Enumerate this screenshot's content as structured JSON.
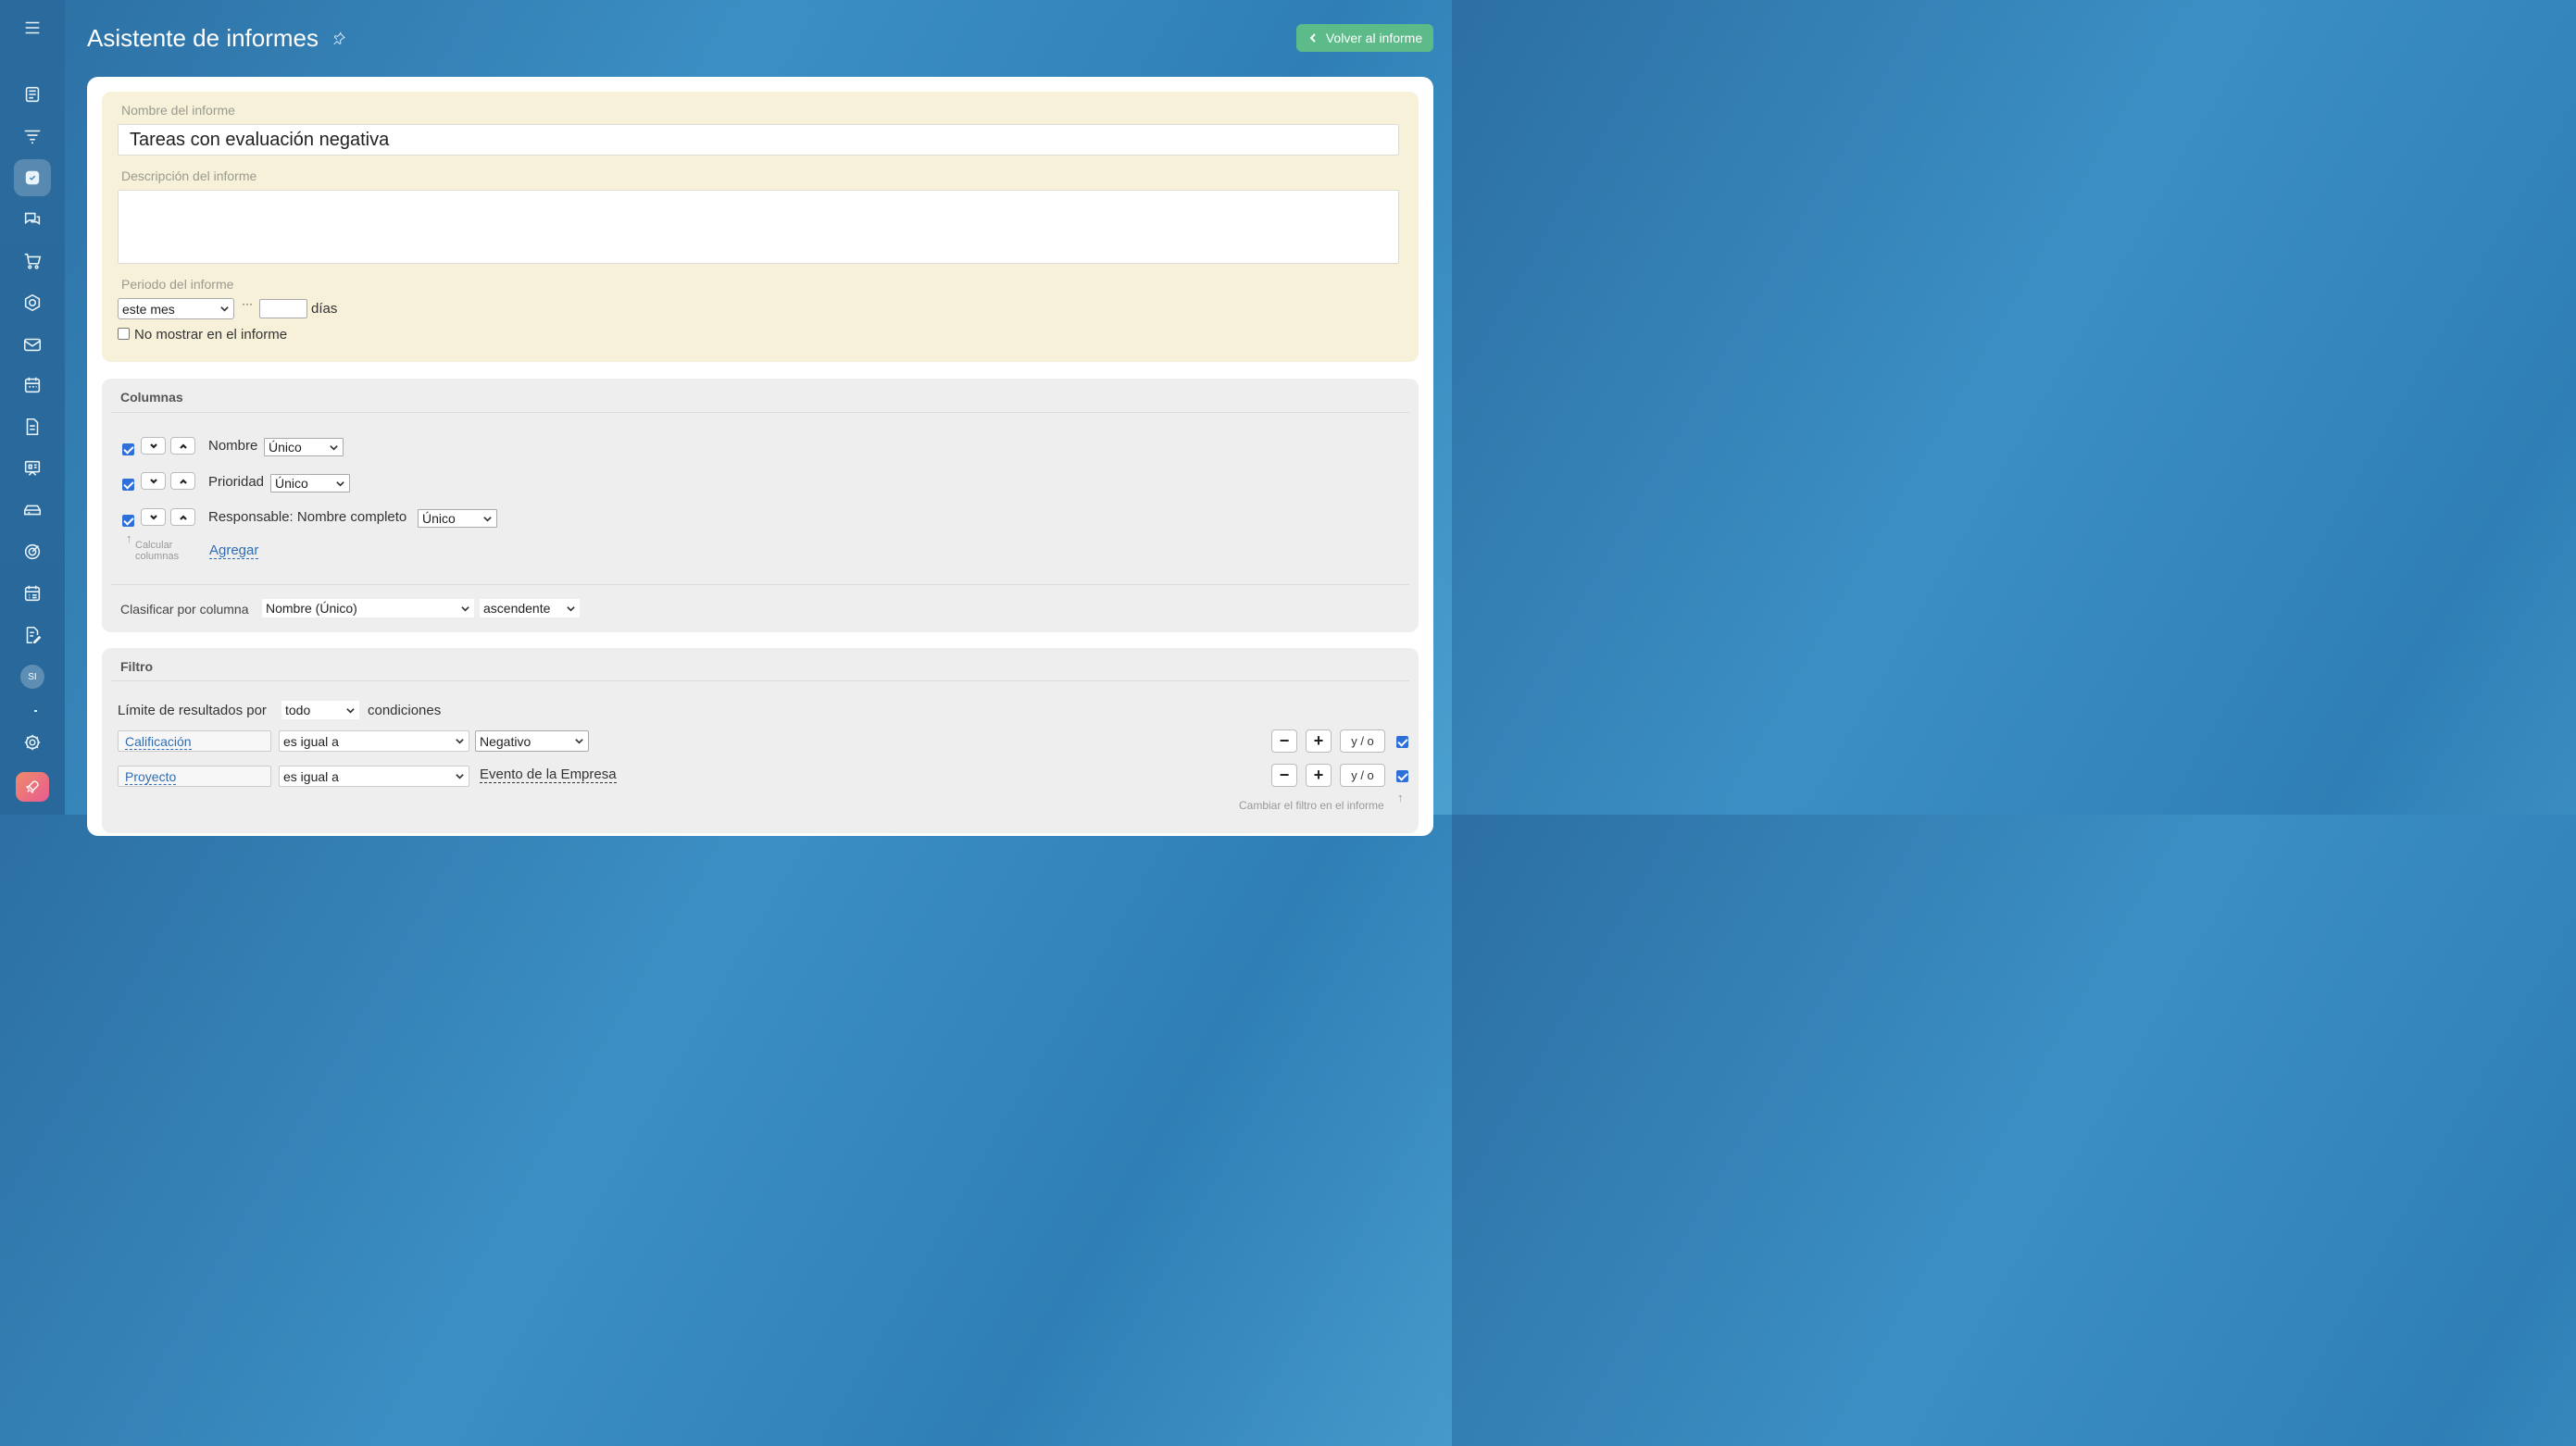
{
  "header": {
    "title": "Asistente de informes",
    "back_button": "Volver al informe"
  },
  "sidebar": {
    "avatar": "SI",
    "items": [
      "menu-icon",
      "feed-icon",
      "filter-icon",
      "tasks-icon",
      "chat-icon",
      "cart-icon",
      "hexagon-icon",
      "mail-icon",
      "calendar-icon",
      "document-icon",
      "presentation-icon",
      "storage-icon",
      "target-icon",
      "planner-icon",
      "edit-doc-icon",
      "settings-icon",
      "rocket-icon"
    ]
  },
  "report": {
    "name_label": "Nombre del informe",
    "name_value": "Tareas con evaluación negativa",
    "description_label": "Descripción del informe",
    "description_value": "",
    "period_label": "Periodo del informe",
    "period_value": "este mes",
    "period_ellipsis": "···",
    "days_value": "",
    "days_label": "días",
    "hide_label": "No mostrar en el informe",
    "hide_checked": false
  },
  "columns": {
    "heading": "Columnas",
    "rows": [
      {
        "label": "Nombre",
        "aggregate": "Único",
        "checked": true
      },
      {
        "label": "Prioridad",
        "aggregate": "Único",
        "checked": true
      },
      {
        "label": "Responsable: Nombre completo",
        "aggregate": "Único",
        "checked": true
      }
    ],
    "calc_note_line1": "Calcular",
    "calc_note_line2": "columnas",
    "add_link": "Agregar",
    "sort_label": "Clasificar por columna",
    "sort_column": "Nombre (Único)",
    "sort_order": "ascendente"
  },
  "filter": {
    "heading": "Filtro",
    "limit_prefix": "Límite de resultados por",
    "limit_value": "todo",
    "limit_suffix": "condiciones",
    "conditions": [
      {
        "field": "Calificación",
        "operator": "es igual a",
        "value": "Negativo",
        "value_type": "select",
        "checked": true
      },
      {
        "field": "Proyecto",
        "operator": "es igual a",
        "value": "Evento de la Empresa",
        "value_type": "link",
        "checked": true
      }
    ],
    "minus": "−",
    "plus": "+",
    "andor": "y / o",
    "change_note": "Cambiar el filtro en el informe"
  },
  "colors": {
    "accent_green": "#5dbb8a",
    "name_panel_bg": "#f7f1da",
    "link_blue": "#2e6db5",
    "checkbox_blue": "#2f6fd8"
  }
}
